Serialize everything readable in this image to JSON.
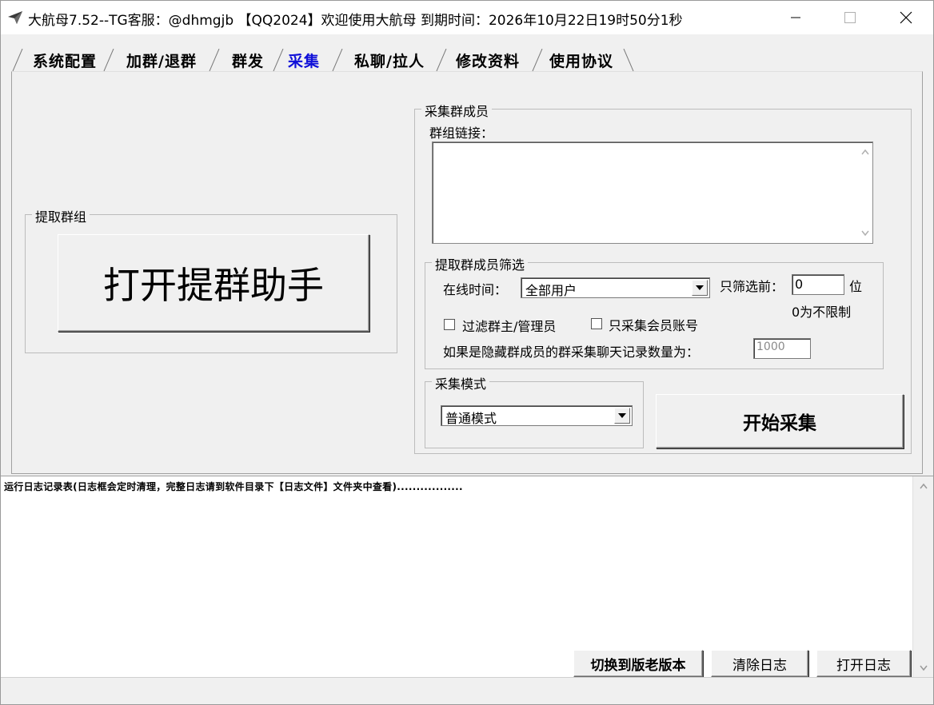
{
  "window": {
    "title": "大航母7.52--TG客服：@dhmgjb 【QQ2024】欢迎使用大航母 到期时间：2026年10月22日19时50分1秒"
  },
  "tabs": [
    {
      "label": "系统配置",
      "active": false
    },
    {
      "label": "加群/退群",
      "active": false
    },
    {
      "label": "群发",
      "active": false
    },
    {
      "label": "采集",
      "active": true
    },
    {
      "label": "私聊/拉人",
      "active": false
    },
    {
      "label": "修改资料",
      "active": false
    },
    {
      "label": "使用协议",
      "active": false
    }
  ],
  "extract_group": {
    "title": "提取群组",
    "button_label": "打开提群助手"
  },
  "collect_members": {
    "title": "采集群成员",
    "link_label": "群组链接：",
    "link_value": ""
  },
  "filter": {
    "title": "提取群成员筛选",
    "online_time_label": "在线时间：",
    "online_time_value": "全部用户",
    "only_first_label": "只筛选前：",
    "only_first_value": "0",
    "unit": "位",
    "hint": "0为不限制",
    "filter_admin_label": "过滤群主/管理员",
    "filter_admin_checked": false,
    "premium_only_label": "只采集会员账号",
    "premium_only_checked": false,
    "hidden_members_label": "如果是隐藏群成员的群采集聊天记录数量为：",
    "hidden_members_value": "1000"
  },
  "mode": {
    "title": "采集模式",
    "value": "普通模式"
  },
  "start_button_label": "开始采集",
  "log": {
    "header": "运行日志记录表(日志框会定时清理，完整日志请到软件目录下【日志文件】文件夹中查看)................."
  },
  "log_buttons": {
    "switch_old": "切换到版老版本",
    "clear": "清除日志",
    "open": "打开日志"
  }
}
